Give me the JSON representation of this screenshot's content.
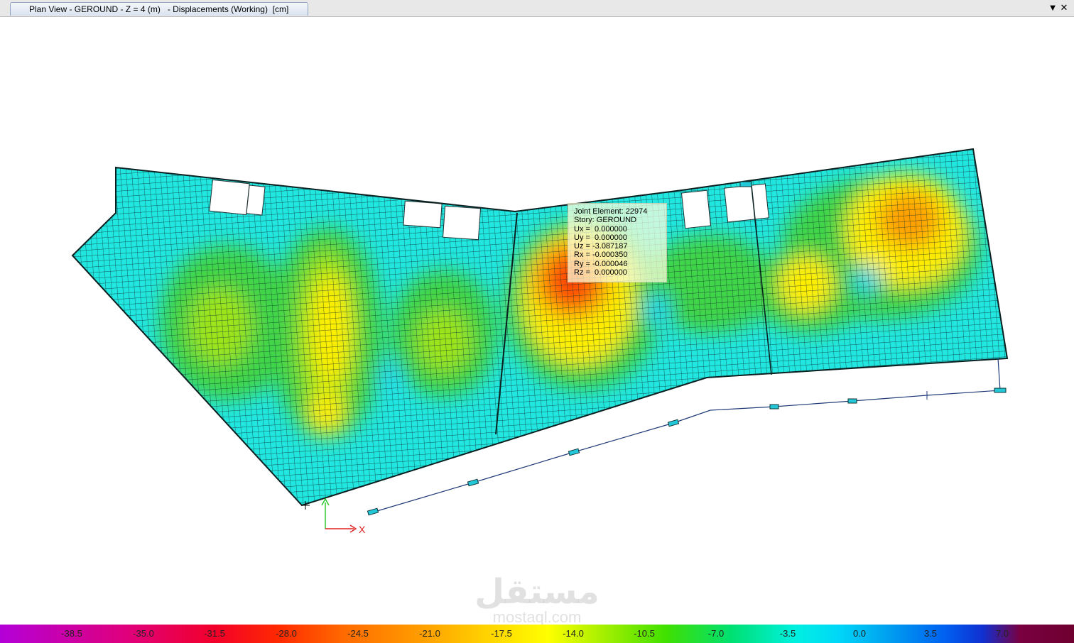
{
  "window": {
    "tab_title": "Plan View - GEROUND - Z = 4 (m)   - Displacements (Working)  [cm]",
    "dropdown_icon": "chevron-down-icon",
    "close_icon": "close-icon"
  },
  "tooltip": {
    "lines": [
      "Joint Element: 22974",
      "Story: GEROUND",
      "Ux =  0.000000",
      "Uy =  0.000000",
      "Uz = -3.087187",
      "Rx = -0.000350",
      "Ry = -0.000046",
      "Rz =  0.000000"
    ]
  },
  "axis": {
    "x_label": "X"
  },
  "legend": {
    "unit": "cm",
    "values": [
      "-38.5",
      "-35.0",
      "-31.5",
      "-28.0",
      "-24.5",
      "-21.0",
      "-17.5",
      "-14.0",
      "-10.5",
      "-7.0",
      "-3.5",
      "0.0",
      "3.5",
      "7.0"
    ]
  },
  "watermark": {
    "arabic": "مستقل",
    "latin": "mostaql.com"
  },
  "colors": {
    "base": "#22e6e0",
    "grid": "#003838",
    "low": "#3cd640",
    "mid": "#ffee00",
    "high": "#ff5a00",
    "peak": "#ee1c00"
  }
}
